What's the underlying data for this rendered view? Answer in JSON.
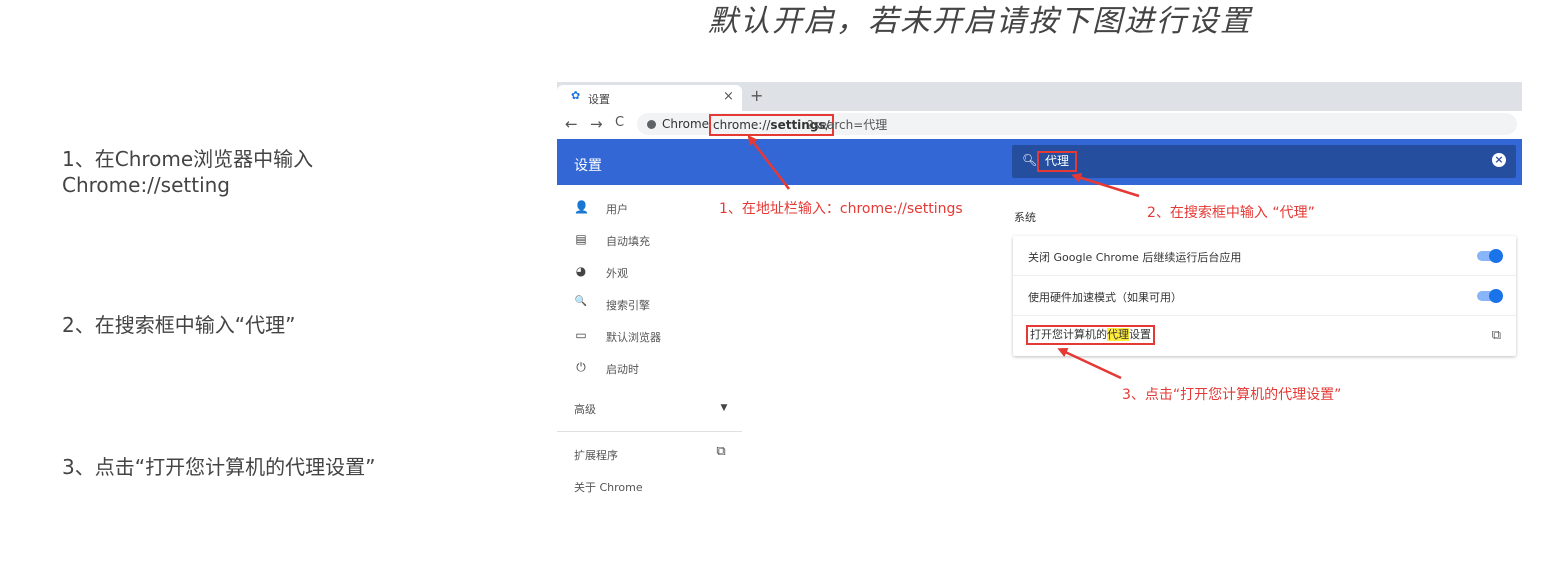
{
  "page_title": "默认开启，若未开启请按下图进行设置",
  "steps": [
    {
      "line1": "1、在Chrome浏览器中输入",
      "line2": "Chrome://setting"
    },
    {
      "line1": "2、在搜索框中输入“代理”"
    },
    {
      "line1": "3、点击“打开您计算机的代理设置”"
    }
  ],
  "browser": {
    "tab_title": "设置",
    "tab_close": "×",
    "new_tab": "+",
    "nav": {
      "back": "←",
      "forward": "→",
      "reload": "C"
    },
    "site_label": "Chrome",
    "url_prefix": "chrome://",
    "url_bold": "settings",
    "url_suffix": "/",
    "url_rest": "?search=代理",
    "settings_title": "设置",
    "search_value": "代理",
    "sidebar": [
      {
        "icon": "person-icon",
        "glyph": "👤",
        "label": "用户"
      },
      {
        "icon": "clipboard-icon",
        "glyph": "▤",
        "label": "自动填充"
      },
      {
        "icon": "palette-icon",
        "glyph": "◕",
        "label": "外观"
      },
      {
        "icon": "search-icon",
        "glyph": "🔍",
        "label": "搜索引擎"
      },
      {
        "icon": "browser-icon",
        "glyph": "▭",
        "label": "默认浏览器"
      },
      {
        "icon": "power-icon",
        "glyph": "⏻",
        "label": "启动时"
      }
    ],
    "advanced": "高级",
    "extensions": "扩展程序",
    "about": "关于 Chrome",
    "section_title": "系统",
    "rows": [
      {
        "label": "关闭 Google Chrome 后继续运行后台应用",
        "toggle": true
      },
      {
        "label": "使用硬件加速模式（如果可用）",
        "toggle": true
      },
      {
        "label_pre": "打开您计算机的",
        "label_hl": "代理",
        "label_post": "设置",
        "external": true
      }
    ]
  },
  "annotations": {
    "a1": "1、在地址栏输入：chrome://settings",
    "a2": "2、在搜索框中输入 “代理”",
    "a3": "3、点击“打开您计算机的代理设置”"
  },
  "colors": {
    "accent": "#3367d6",
    "annotation": "#e53935",
    "highlight": "#ffeb3b"
  }
}
